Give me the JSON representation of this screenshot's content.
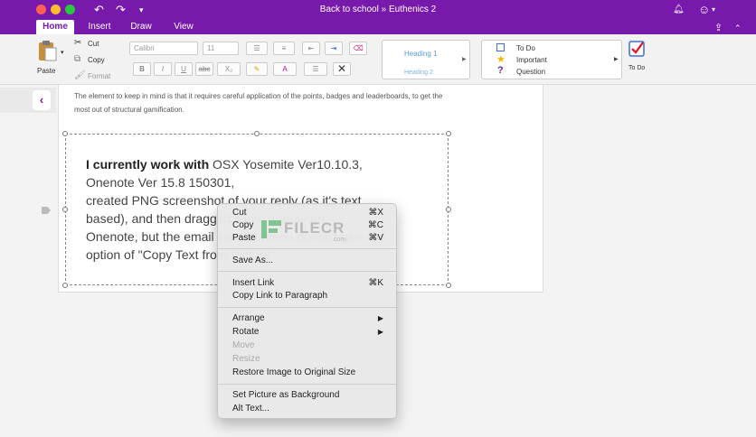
{
  "title_bar": {
    "notebook": "Back to school",
    "separator": "»",
    "section": "Euthenics 2",
    "undo_icon": "undo-icon",
    "redo_icon": "redo-icon",
    "customize_icon": "customize-toolbar-icon",
    "bell_icon": "bell-icon",
    "smiley_icon": "smiley-icon",
    "share_icon": "share-icon",
    "collapse_icon": "collapse-ribbon-icon",
    "accent_color": "#7719aa"
  },
  "menu": {
    "tabs": [
      "Home",
      "Insert",
      "Draw",
      "View"
    ],
    "active": "Home"
  },
  "ribbon": {
    "paste": "Paste",
    "cut": "Cut",
    "copy": "Copy",
    "format": "Format",
    "font_name": "Calibri",
    "font_size": "11",
    "bold": "B",
    "italic": "I",
    "underline": "U",
    "strike": "abc",
    "subscript": "X₂",
    "heading1": "Heading 1",
    "heading2": "Heading 2",
    "tags": [
      {
        "label": "To Do",
        "icon": "checkbox-icon"
      },
      {
        "label": "Important",
        "icon": "star-icon"
      },
      {
        "label": "Question",
        "icon": "question-icon"
      }
    ],
    "todo_label": "To Do"
  },
  "page": {
    "paragraph": "The element to keep in mind is that it requires careful application of the points, badges and leaderboards, to get the most out of structural gamification.",
    "image_text": {
      "bold": "I currently work with",
      "line1_rest": " OSX Yosemite Ver10.10.3,",
      "line2": "Onenote Ver 15.8 150301,",
      "line3": "created PNG screenshot of your reply (as it's text",
      "line4": "based), and then dragged it into a page on",
      "line5": "Onenote, but the email context menu doesn't give the",
      "line6": "option of \"Copy Text from Picture\""
    },
    "watermark": "FILECR",
    "watermark_sub": ".com"
  },
  "context_menu": {
    "items": [
      {
        "label": "Cut",
        "shortcut": "⌘X",
        "enabled": true
      },
      {
        "label": "Copy",
        "shortcut": "⌘C",
        "enabled": true
      },
      {
        "label": "Paste",
        "shortcut": "⌘V",
        "enabled": true
      },
      {
        "label": "Save As...",
        "shortcut": "",
        "enabled": true
      },
      {
        "label": "Insert Link",
        "shortcut": "⌘K",
        "enabled": true
      },
      {
        "label": "Copy Link to Paragraph",
        "shortcut": "",
        "enabled": true
      },
      {
        "label": "Arrange",
        "shortcut": "▶",
        "enabled": true
      },
      {
        "label": "Rotate",
        "shortcut": "▶",
        "enabled": true
      },
      {
        "label": "Move",
        "shortcut": "",
        "enabled": false
      },
      {
        "label": "Resize",
        "shortcut": "",
        "enabled": false
      },
      {
        "label": "Restore Image to Original Size",
        "shortcut": "",
        "enabled": true
      },
      {
        "label": "Set Picture as Background",
        "shortcut": "",
        "enabled": true
      },
      {
        "label": "Alt Text...",
        "shortcut": "",
        "enabled": true
      }
    ]
  }
}
